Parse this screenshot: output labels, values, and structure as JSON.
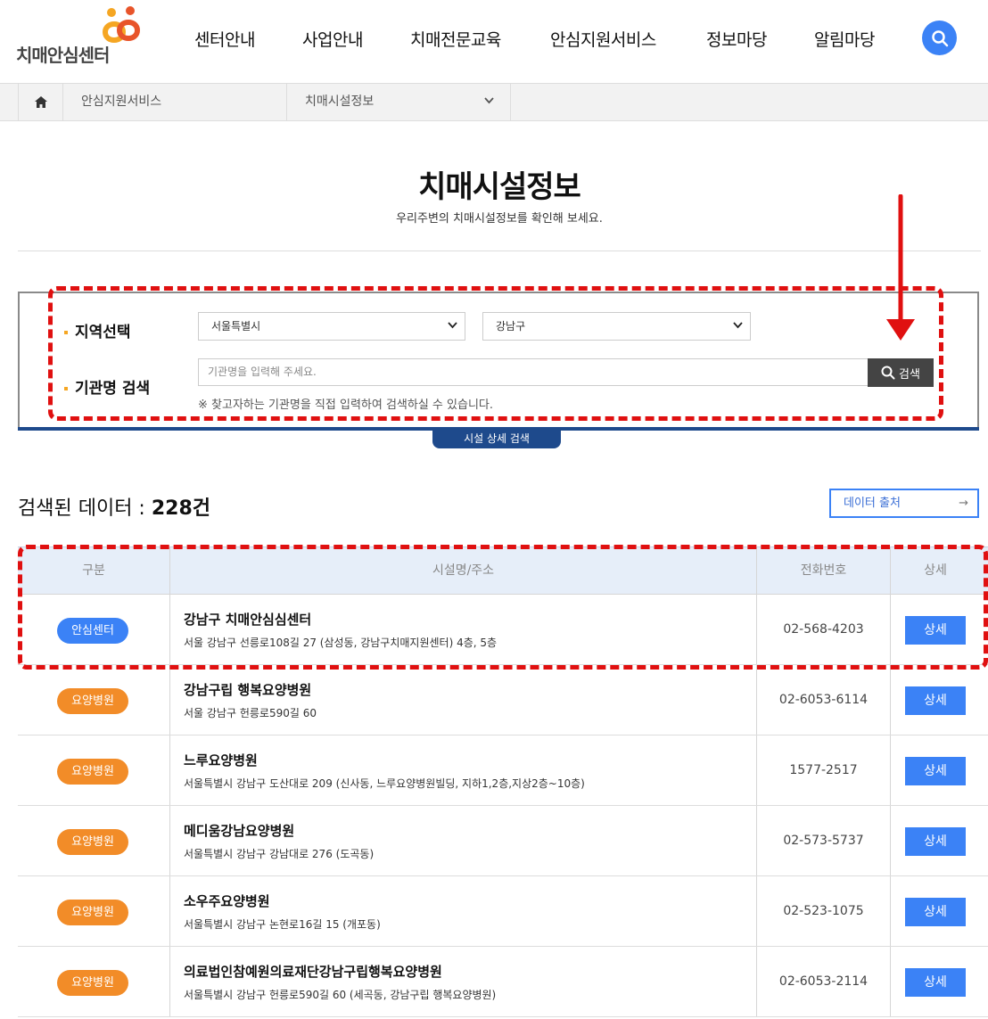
{
  "header": {
    "logo_text": "치매안심센터",
    "nav": [
      "센터안내",
      "사업안내",
      "치매전문교육",
      "안심지원서비스",
      "정보마당",
      "알림마당"
    ]
  },
  "breadcrumb": {
    "items": [
      "안심지원서비스",
      "치매시설정보"
    ]
  },
  "page": {
    "title": "치매시설정보",
    "subtitle": "우리주변의 치매시설정보를 확인해 보세요."
  },
  "search": {
    "region_label": "지역선택",
    "name_label": "기관명 검색",
    "city_value": "서울특별시",
    "district_value": "강남구",
    "input_placeholder": "기관명을 입력해 주세요.",
    "button_label": "검색",
    "note": "※ 찾고자하는 기관명을 직접 입력하여 검색하실 수 있습니다.",
    "tab_label": "시설 상세 검색"
  },
  "results": {
    "count_prefix": "검색된 데이터 : ",
    "count_value": "228건",
    "source_button": "데이터 출처",
    "columns": [
      "구분",
      "시설명/주소",
      "전화번호",
      "상세"
    ],
    "detail_label": "상세",
    "rows": [
      {
        "type": "안심센터",
        "name": "강남구 치매안심심센터",
        "address": "서울 강남구 선릉로108길 27 (삼성동, 강남구치매지원센터) 4층, 5층",
        "phone": "02-568-4203"
      },
      {
        "type": "요양병원",
        "name": "강남구립 행복요양병원",
        "address": "서울 강남구 헌릉로590길 60",
        "phone": "02-6053-6114"
      },
      {
        "type": "요양병원",
        "name": "느루요양병원",
        "address": "서울특별시 강남구 도산대로 209 (신사동, 느루요양병원빌딩, 지하1,2층,지상2층~10층)",
        "phone": "1577-2517"
      },
      {
        "type": "요양병원",
        "name": "메디움강남요양병원",
        "address": "서울특별시 강남구 강남대로 276 (도곡동)",
        "phone": "02-573-5737"
      },
      {
        "type": "요양병원",
        "name": "소우주요양병원",
        "address": "서울특별시 강남구 논현로16길 15 (개포동)",
        "phone": "02-523-1075"
      },
      {
        "type": "요양병원",
        "name": "의료법인참예원의료재단강남구립행복요양병원",
        "address": "서울특별시 강남구 헌릉로590길 60 (세곡동, 강남구립 행복요양병원)",
        "phone": "02-6053-2114"
      }
    ]
  },
  "colors": {
    "accent_blue": "#3b82f6",
    "navy": "#1e4a8c",
    "badge_center": "#3b82f6",
    "badge_hospital": "#f28c28",
    "annotation_red": "#e01010"
  }
}
